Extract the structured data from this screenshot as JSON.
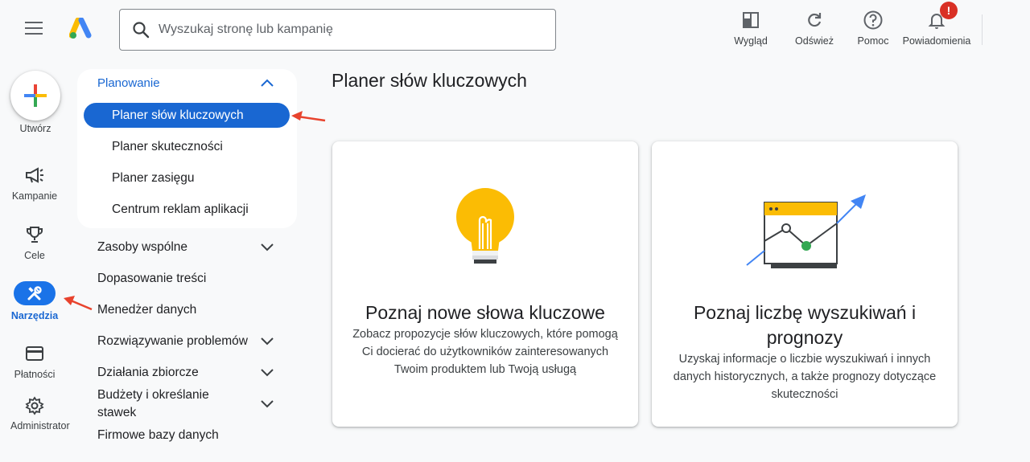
{
  "search": {
    "placeholder": "Wyszukaj stronę lub kampanię"
  },
  "toolbar": {
    "appearance_label": "Wygląd",
    "refresh_label": "Odśwież",
    "help_label": "Pomoc",
    "notifications_label": "Powiadomienia",
    "notifications_badge": "!"
  },
  "rail": {
    "create_label": "Utwórz",
    "items": [
      {
        "label": "Kampanie",
        "icon": "megaphone-icon"
      },
      {
        "label": "Cele",
        "icon": "trophy-icon"
      },
      {
        "label": "Narzędzia",
        "icon": "tools-icon",
        "active": true
      },
      {
        "label": "Płatności",
        "icon": "credit-card-icon"
      },
      {
        "label": "Administrator",
        "icon": "gear-icon"
      }
    ]
  },
  "sidebar": {
    "section_title": "Planowanie",
    "sub_items": [
      {
        "label": "Planer słów kluczowych",
        "active": true
      },
      {
        "label": "Planer skuteczności"
      },
      {
        "label": "Planer zasięgu"
      },
      {
        "label": "Centrum reklam aplikacji"
      }
    ],
    "items": [
      {
        "label": "Zasoby wspólne",
        "expandable": true
      },
      {
        "label": "Dopasowanie treści",
        "expandable": false
      },
      {
        "label": "Menedżer danych",
        "expandable": false
      },
      {
        "label": "Rozwiązywanie problemów",
        "expandable": true
      },
      {
        "label": "Działania zbiorcze",
        "expandable": true
      },
      {
        "label": "Budżety i określanie stawek",
        "expandable": true
      },
      {
        "label": "Firmowe bazy danych",
        "expandable": false
      }
    ]
  },
  "main": {
    "title": "Planer słów kluczowych",
    "cards": [
      {
        "title": "Poznaj nowe słowa kluczowe",
        "description": "Zobacz propozycje słów kluczowych, które pomogą Ci docierać do użytkowników zainteresowanych Twoim produktem lub Twoją usługą",
        "icon": "lightbulb-icon"
      },
      {
        "title": "Poznaj liczbę wyszukiwań i prognozy",
        "description": "Uzyskaj informacje o liczbie wyszukiwań i innych danych historycznych, a także prognozy dotyczące skuteczności",
        "icon": "trend-chart-icon"
      }
    ]
  },
  "colors": {
    "accent": "#1a73e8",
    "active_nav": "#1967d2",
    "annotation_arrow": "#e8432d",
    "bulb": "#fbbc04",
    "badge": "#d93025"
  }
}
